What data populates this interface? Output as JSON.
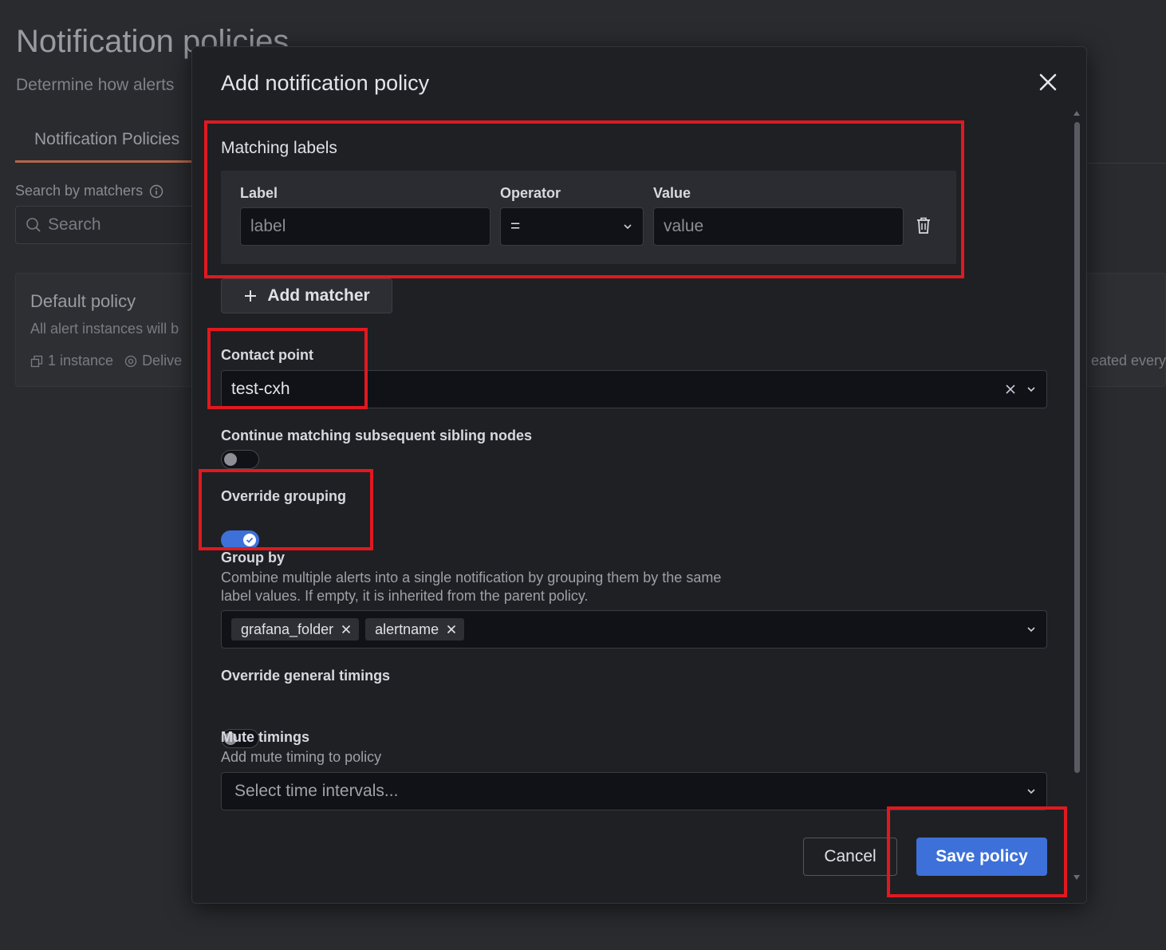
{
  "background": {
    "page_title": "Notification policies",
    "page_subtitle": "Determine how alerts",
    "tab_label": "Notification Policies",
    "search_label": "Search by matchers",
    "search_placeholder": "Search",
    "default_policy_title": "Default policy",
    "default_policy_desc": "All alert instances will b",
    "instance_count": "1 instance",
    "delivery_text": "Delive",
    "repeat_text": "eated every"
  },
  "modal": {
    "title": "Add notification policy",
    "matching_labels": {
      "title": "Matching labels",
      "label_header": "Label",
      "operator_header": "Operator",
      "value_header": "Value",
      "label_placeholder": "label",
      "operator_value": "=",
      "value_placeholder": "value"
    },
    "add_matcher_label": "Add matcher",
    "contact_point": {
      "label": "Contact point",
      "value": "test-cxh"
    },
    "continue_matching": {
      "label": "Continue matching subsequent sibling nodes",
      "enabled": false
    },
    "override_grouping": {
      "label": "Override grouping",
      "enabled": true
    },
    "group_by": {
      "label": "Group by",
      "description_line1": "Combine multiple alerts into a single notification by grouping them by the same",
      "description_line2": "label values. If empty, it is inherited from the parent policy.",
      "tags": [
        "grafana_folder",
        "alertname"
      ]
    },
    "override_timings": {
      "label": "Override general timings",
      "enabled": false
    },
    "mute_timings": {
      "label": "Mute timings",
      "description": "Add mute timing to policy",
      "placeholder": "Select time intervals..."
    },
    "cancel_label": "Cancel",
    "save_label": "Save policy"
  },
  "colors": {
    "primary": "#3d71d9",
    "highlight": "#e0191f",
    "modal_bg": "#1f2024",
    "input_bg": "#111217"
  }
}
